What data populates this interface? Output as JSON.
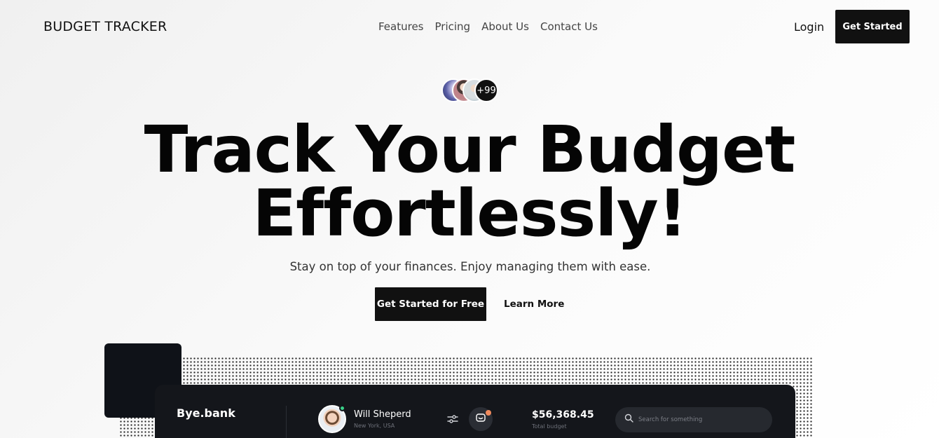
{
  "nav": {
    "brand": "BUDGET TRACKER",
    "links": [
      "Features",
      "Pricing",
      "About Us",
      "Contact Us"
    ],
    "login": "Login",
    "cta": "Get Started"
  },
  "hero": {
    "avatar_count": "+99",
    "title_line1": "Track Your Budget",
    "title_line2": "Effortlessly!",
    "subtitle": "Stay on top of your finances. Enjoy managing them with ease.",
    "primary_cta": "Get Started for Free",
    "secondary_cta": "Learn More"
  },
  "dashboard": {
    "brand": "Bye.bank",
    "user_name": "Will Sheperd",
    "user_location": "New York, USA",
    "total_amount": "$56,368.45",
    "total_label": "Total budget",
    "search_placeholder": "Search for something"
  },
  "colors": {
    "dark": "#111111",
    "dashboard_bg": "#14161b",
    "online": "#3ad18a",
    "notification": "#f08a5d"
  },
  "icons": [
    "filter-icon",
    "wallet-icon",
    "search-icon"
  ]
}
